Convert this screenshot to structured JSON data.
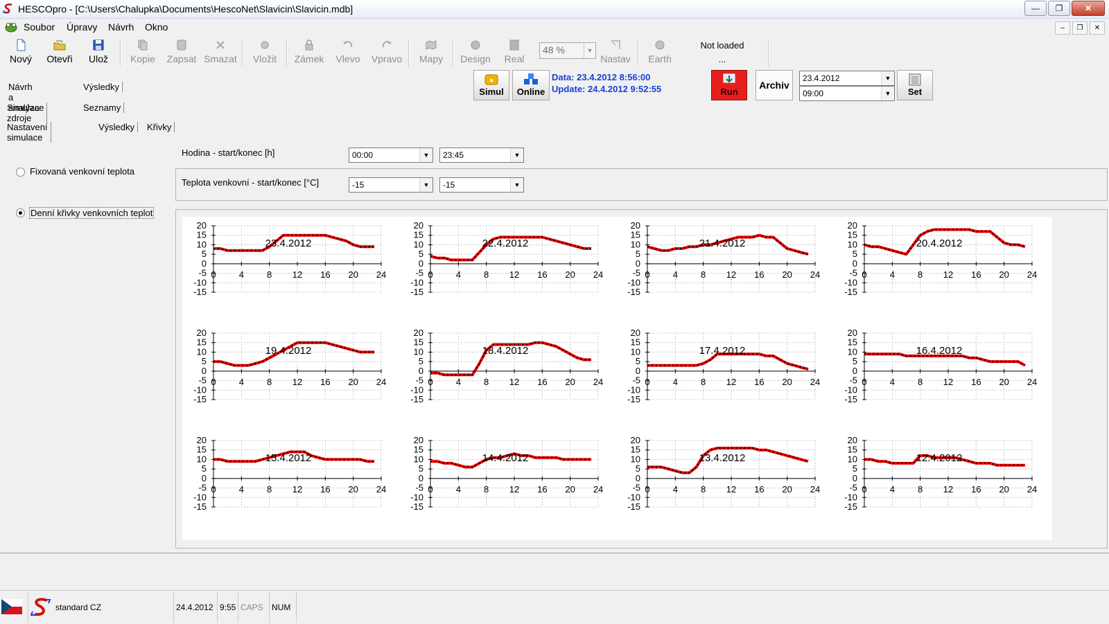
{
  "window": {
    "title": "HESCOpro - [C:\\Users\\Chalupka\\Documents\\HescoNet\\Slavicin\\Slavicin.mdb]"
  },
  "menu": [
    "Soubor",
    "Úpravy",
    "Návrh",
    "Okno"
  ],
  "toolbar": {
    "buttons": [
      {
        "label": "Nový",
        "icon": "new-document-icon",
        "enabled": true
      },
      {
        "label": "Otevři",
        "icon": "open-folder-icon",
        "enabled": true
      },
      {
        "label": "Ulož",
        "icon": "save-disk-icon",
        "enabled": true
      },
      {
        "label": "Kopie",
        "icon": "copy-icon",
        "enabled": false
      },
      {
        "label": "Zapsat",
        "icon": "write-icon",
        "enabled": false
      },
      {
        "label": "Smazat",
        "icon": "delete-icon",
        "enabled": false
      },
      {
        "label": "Vložit",
        "icon": "insert-icon",
        "enabled": false
      },
      {
        "label": "Zámek",
        "icon": "lock-icon",
        "enabled": false
      },
      {
        "label": "Vlevo",
        "icon": "rotate-left-icon",
        "enabled": false
      },
      {
        "label": "Vpravo",
        "icon": "rotate-right-icon",
        "enabled": false
      },
      {
        "label": "Mapy",
        "icon": "map-icon",
        "enabled": false
      },
      {
        "label": "Design",
        "icon": "design-icon",
        "enabled": false
      },
      {
        "label": "Real",
        "icon": "real-icon",
        "enabled": false
      },
      {
        "label": "Nastav",
        "icon": "nastav-icon",
        "enabled": false
      },
      {
        "label": "Earth",
        "icon": "earth-icon",
        "enabled": false
      }
    ],
    "zoom": "48 %",
    "not_loaded": "Not loaded",
    "not_loaded_sub": "..."
  },
  "actions": {
    "simul": "Simul",
    "online": "Online",
    "data_line": "Data: 23.4.2012 8:56:00",
    "update_line": "Update: 24.4.2012 9:52:55",
    "run": "Run",
    "archiv": "Archiv",
    "archiv_date": "23.4.2012",
    "archiv_time": "09:00",
    "set": "Set"
  },
  "tabs": {
    "level1": [
      "Návrh a analýza",
      "Výsledky"
    ],
    "level2": [
      "Simulace zdroje",
      "Seznamy"
    ],
    "level3": [
      "Nastavení simulace",
      "Výsledky",
      "Křivky"
    ]
  },
  "settings": {
    "radio_fixed": "Fixovaná venkovní teplota",
    "radio_daily": "Denní křivky venkovních teplot",
    "hour_label": "Hodina - start/konec [h]",
    "hour_start": "00:00",
    "hour_end": "23:45",
    "temp_label": "Teplota venkovní - start/konec [°C]",
    "temp_start": "-15",
    "temp_end": "-15"
  },
  "chart_data": {
    "type": "line",
    "x_ticks": [
      0,
      4,
      8,
      12,
      16,
      20,
      24
    ],
    "y_ticks": [
      20,
      15,
      10,
      5,
      0,
      -5,
      -10,
      -15
    ],
    "xlim": [
      0,
      24
    ],
    "ylim": [
      -15,
      20
    ],
    "grid": true,
    "line_color": "#e60000",
    "marker_color": "#000000",
    "panels": [
      {
        "title": "23.4.2012",
        "x": [
          0,
          1,
          2,
          3,
          4,
          5,
          6,
          7,
          8,
          9,
          10,
          11,
          12,
          13,
          14,
          15,
          16,
          17,
          18,
          19,
          20,
          21,
          22,
          23
        ],
        "values": [
          8,
          8,
          7,
          7,
          7,
          7,
          7,
          7,
          9,
          12,
          15,
          15,
          15,
          15,
          15,
          15,
          15,
          14,
          13,
          12,
          10,
          9,
          9,
          9
        ]
      },
      {
        "title": "22.4.2012",
        "x": [
          0,
          1,
          2,
          3,
          4,
          5,
          6,
          7,
          8,
          9,
          10,
          11,
          12,
          13,
          14,
          15,
          16,
          17,
          18,
          19,
          20,
          21,
          22,
          23
        ],
        "values": [
          4,
          3,
          3,
          2,
          2,
          2,
          2,
          6,
          10,
          13,
          14,
          14,
          14,
          14,
          14,
          14,
          14,
          13,
          12,
          11,
          10,
          9,
          8,
          8
        ]
      },
      {
        "title": "21.4.2012",
        "x": [
          0,
          1,
          2,
          3,
          4,
          5,
          6,
          7,
          8,
          9,
          10,
          11,
          12,
          13,
          14,
          15,
          16,
          17,
          18,
          19,
          20,
          21,
          22,
          23
        ],
        "values": [
          9,
          8,
          7,
          7,
          8,
          8,
          9,
          9,
          10,
          10,
          11,
          12,
          13,
          14,
          14,
          14,
          15,
          14,
          14,
          11,
          8,
          7,
          6,
          5
        ]
      },
      {
        "title": "20.4.2012",
        "x": [
          0,
          1,
          2,
          3,
          4,
          5,
          6,
          7,
          8,
          9,
          10,
          11,
          12,
          13,
          14,
          15,
          16,
          17,
          18,
          19,
          20,
          21,
          22,
          23
        ],
        "values": [
          10,
          9,
          9,
          8,
          7,
          6,
          5,
          10,
          15,
          17,
          18,
          18,
          18,
          18,
          18,
          18,
          17,
          17,
          17,
          14,
          11,
          10,
          10,
          9
        ]
      },
      {
        "title": "19.4.2012",
        "x": [
          0,
          1,
          2,
          3,
          4,
          5,
          6,
          7,
          8,
          9,
          10,
          11,
          12,
          13,
          14,
          15,
          16,
          17,
          18,
          19,
          20,
          21,
          22,
          23
        ],
        "values": [
          5,
          5,
          4,
          3,
          3,
          3,
          4,
          5,
          7,
          9,
          11,
          13,
          15,
          15,
          15,
          15,
          15,
          14,
          13,
          12,
          11,
          10,
          10,
          10
        ]
      },
      {
        "title": "18.4.2012",
        "x": [
          0,
          1,
          2,
          3,
          4,
          5,
          6,
          7,
          8,
          9,
          10,
          11,
          12,
          13,
          14,
          15,
          16,
          17,
          18,
          19,
          20,
          21,
          22,
          23
        ],
        "values": [
          -1,
          -1,
          -2,
          -2,
          -2,
          -2,
          -2,
          4,
          11,
          14,
          14,
          14,
          14,
          14,
          14,
          15,
          15,
          14,
          13,
          11,
          9,
          7,
          6,
          6
        ]
      },
      {
        "title": "17.4.2012",
        "x": [
          0,
          1,
          2,
          3,
          4,
          5,
          6,
          7,
          8,
          9,
          10,
          11,
          12,
          13,
          14,
          15,
          16,
          17,
          18,
          19,
          20,
          21,
          22,
          23
        ],
        "values": [
          3,
          3,
          3,
          3,
          3,
          3,
          3,
          3,
          4,
          6,
          9,
          9,
          9,
          9,
          9,
          9,
          9,
          8,
          8,
          6,
          4,
          3,
          2,
          1
        ]
      },
      {
        "title": "16.4.2012",
        "x": [
          0,
          1,
          2,
          3,
          4,
          5,
          6,
          7,
          8,
          9,
          10,
          11,
          12,
          13,
          14,
          15,
          16,
          17,
          18,
          19,
          20,
          21,
          22,
          23
        ],
        "values": [
          9,
          9,
          9,
          9,
          9,
          9,
          8,
          8,
          8,
          8,
          8,
          8,
          8,
          8,
          8,
          7,
          7,
          6,
          5,
          5,
          5,
          5,
          5,
          3
        ]
      },
      {
        "title": "15.4.2012",
        "x": [
          0,
          1,
          2,
          3,
          4,
          5,
          6,
          7,
          8,
          9,
          10,
          11,
          12,
          13,
          14,
          15,
          16,
          17,
          18,
          19,
          20,
          21,
          22,
          23
        ],
        "values": [
          10,
          10,
          9,
          9,
          9,
          9,
          9,
          10,
          11,
          12,
          13,
          14,
          14,
          14,
          12,
          11,
          10,
          10,
          10,
          10,
          10,
          10,
          9,
          9
        ]
      },
      {
        "title": "14.4.2012",
        "x": [
          0,
          1,
          2,
          3,
          4,
          5,
          6,
          7,
          8,
          9,
          10,
          11,
          12,
          13,
          14,
          15,
          16,
          17,
          18,
          19,
          20,
          21,
          22,
          23
        ],
        "values": [
          9,
          9,
          8,
          8,
          7,
          6,
          6,
          8,
          10,
          11,
          11,
          12,
          13,
          12,
          12,
          11,
          11,
          11,
          11,
          10,
          10,
          10,
          10,
          10
        ]
      },
      {
        "title": "13.4.2012",
        "x": [
          0,
          1,
          2,
          3,
          4,
          5,
          6,
          7,
          8,
          9,
          10,
          11,
          12,
          13,
          14,
          15,
          16,
          17,
          18,
          19,
          20,
          21,
          22,
          23
        ],
        "values": [
          6,
          6,
          6,
          5,
          4,
          3,
          3,
          6,
          12,
          15,
          16,
          16,
          16,
          16,
          16,
          16,
          15,
          15,
          14,
          13,
          12,
          11,
          10,
          9
        ]
      },
      {
        "title": "12.4.2012",
        "x": [
          0,
          1,
          2,
          3,
          4,
          5,
          6,
          7,
          8,
          9,
          10,
          11,
          12,
          13,
          14,
          15,
          16,
          17,
          18,
          19,
          20,
          21,
          22,
          23
        ],
        "values": [
          10,
          10,
          9,
          9,
          8,
          8,
          8,
          8,
          12,
          12,
          11,
          11,
          11,
          11,
          10,
          9,
          8,
          8,
          8,
          7,
          7,
          7,
          7,
          7
        ]
      }
    ]
  },
  "statusbar": {
    "profile": "standard CZ",
    "date": "24.4.2012",
    "time": "9:55",
    "caps": "CAPS",
    "num": "NUM"
  }
}
